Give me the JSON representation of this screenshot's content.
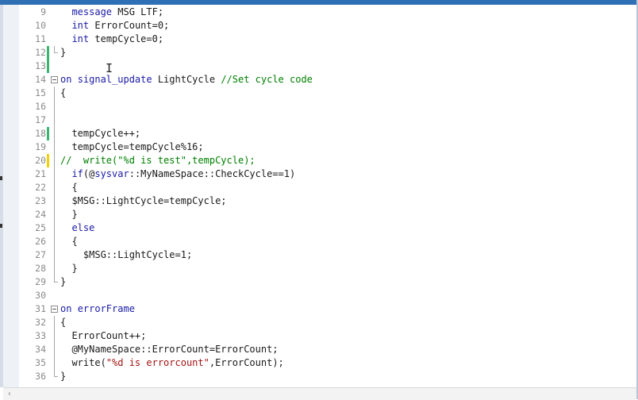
{
  "editor": {
    "lines": [
      {
        "num": "9",
        "segments": [
          {
            "text": "  "
          },
          {
            "text": "message",
            "cls": "kw"
          },
          {
            "text": " MSG LTF;"
          }
        ]
      },
      {
        "num": "10",
        "segments": [
          {
            "text": "  "
          },
          {
            "text": "int",
            "cls": "kw"
          },
          {
            "text": " ErrorCount=0;"
          }
        ]
      },
      {
        "num": "11",
        "segments": [
          {
            "text": "  "
          },
          {
            "text": "int",
            "cls": "kw"
          },
          {
            "text": " tempCycle=0;"
          }
        ]
      },
      {
        "num": "12",
        "marker": "saved",
        "fold": "end",
        "segments": [
          {
            "text": "}"
          }
        ]
      },
      {
        "num": "13",
        "marker": "saved",
        "segments": []
      },
      {
        "num": "14",
        "fold": "start",
        "segments": [
          {
            "text": "on",
            "cls": "kw"
          },
          {
            "text": " "
          },
          {
            "text": "signal_update",
            "cls": "kw"
          },
          {
            "text": " LightCycle "
          },
          {
            "text": "//Set cycle code",
            "cls": "cmt"
          }
        ]
      },
      {
        "num": "15",
        "fold": "line",
        "segments": [
          {
            "text": "{"
          }
        ]
      },
      {
        "num": "16",
        "fold": "line",
        "segments": []
      },
      {
        "num": "17",
        "fold": "line",
        "segments": []
      },
      {
        "num": "18",
        "marker": "saved",
        "fold": "line",
        "segments": [
          {
            "text": "  tempCycle++;"
          }
        ]
      },
      {
        "num": "19",
        "fold": "line",
        "segments": [
          {
            "text": "  tempCycle=tempCycle%16;"
          }
        ]
      },
      {
        "num": "20",
        "marker": "unsaved",
        "fold": "line",
        "segments": [
          {
            "text": "//  write(\"%d is test\",tempCycle);",
            "cls": "cmt"
          }
        ]
      },
      {
        "num": "21",
        "fold": "line",
        "segments": [
          {
            "text": "  "
          },
          {
            "text": "if",
            "cls": "kw"
          },
          {
            "text": "(@"
          },
          {
            "text": "sysvar",
            "cls": "kw"
          },
          {
            "text": "::MyNameSpace::CheckCycle==1)"
          }
        ]
      },
      {
        "num": "22",
        "fold": "line",
        "segments": [
          {
            "text": "  {"
          }
        ]
      },
      {
        "num": "23",
        "fold": "line",
        "segments": [
          {
            "text": "  $MSG::LightCycle=tempCycle;"
          }
        ]
      },
      {
        "num": "24",
        "fold": "line",
        "segments": [
          {
            "text": "  }"
          }
        ]
      },
      {
        "num": "25",
        "fold": "line",
        "segments": [
          {
            "text": "  "
          },
          {
            "text": "else",
            "cls": "kw"
          }
        ]
      },
      {
        "num": "26",
        "fold": "line",
        "segments": [
          {
            "text": "  {"
          }
        ]
      },
      {
        "num": "27",
        "fold": "line",
        "segments": [
          {
            "text": "    $MSG::LightCycle=1;"
          }
        ]
      },
      {
        "num": "28",
        "fold": "line",
        "segments": [
          {
            "text": "  }"
          }
        ]
      },
      {
        "num": "29",
        "fold": "end",
        "segments": [
          {
            "text": "}"
          }
        ]
      },
      {
        "num": "30",
        "segments": []
      },
      {
        "num": "31",
        "fold": "start",
        "segments": [
          {
            "text": "on",
            "cls": "kw"
          },
          {
            "text": " "
          },
          {
            "text": "errorFrame",
            "cls": "kw"
          }
        ]
      },
      {
        "num": "32",
        "fold": "line",
        "segments": [
          {
            "text": "{"
          }
        ]
      },
      {
        "num": "33",
        "fold": "line",
        "segments": [
          {
            "text": "  ErrorCount++;"
          }
        ]
      },
      {
        "num": "34",
        "fold": "line",
        "segments": [
          {
            "text": "  @MyNameSpace::ErrorCount=ErrorCount;"
          }
        ]
      },
      {
        "num": "35",
        "fold": "line",
        "segments": [
          {
            "text": "  write("
          },
          {
            "text": "\"%d is errorcount\"",
            "cls": "str"
          },
          {
            "text": ",ErrorCount);"
          }
        ]
      },
      {
        "num": "36",
        "fold": "end",
        "segments": [
          {
            "text": "}"
          }
        ]
      }
    ]
  },
  "colors": {
    "keyword": "#1a1aa6",
    "comment": "#008000",
    "string": "#a31515",
    "saved_change": "#3cb371",
    "unsaved_change": "#f0d000",
    "top_strip": "#2f6fb3"
  },
  "icons": {
    "text_cursor": "I",
    "scroll_left": "‹"
  }
}
